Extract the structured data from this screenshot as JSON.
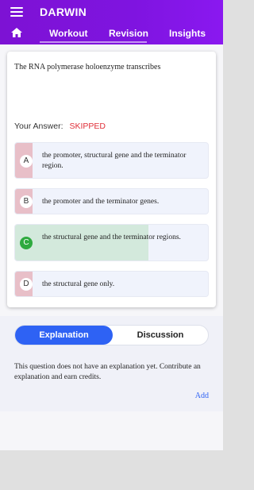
{
  "app": {
    "title": "DARWIN"
  },
  "tabs": [
    {
      "label": "Workout"
    },
    {
      "label": "Revision"
    },
    {
      "label": "Insights"
    }
  ],
  "question": {
    "text": "The RNA polymerase holoenzyme transcribes",
    "answer_label": "Your Answer:",
    "answer_value": "SKIPPED",
    "options": [
      {
        "letter": "A",
        "text": "the promoter, structural gene and the terminator region.",
        "state": "missed"
      },
      {
        "letter": "B",
        "text": "the promoter and the terminator genes.",
        "state": "missed"
      },
      {
        "letter": "C",
        "text": "the structural gene and the terminator regions.",
        "state": "correct"
      },
      {
        "letter": "D",
        "text": "the structural gene only.",
        "state": "missed"
      }
    ]
  },
  "panel": {
    "explanation_tab": "Explanation",
    "discussion_tab": "Discussion",
    "explanation_text": "This question does not have an explanation yet. Contribute an explanation and earn credits.",
    "add_label": "Add"
  },
  "colors": {
    "header": "#7f14e0",
    "accent": "#2e62f4",
    "skipped": "#e0303a",
    "correct_fill": "#d3e9dc",
    "missed_strip": "#e8bfc8"
  }
}
